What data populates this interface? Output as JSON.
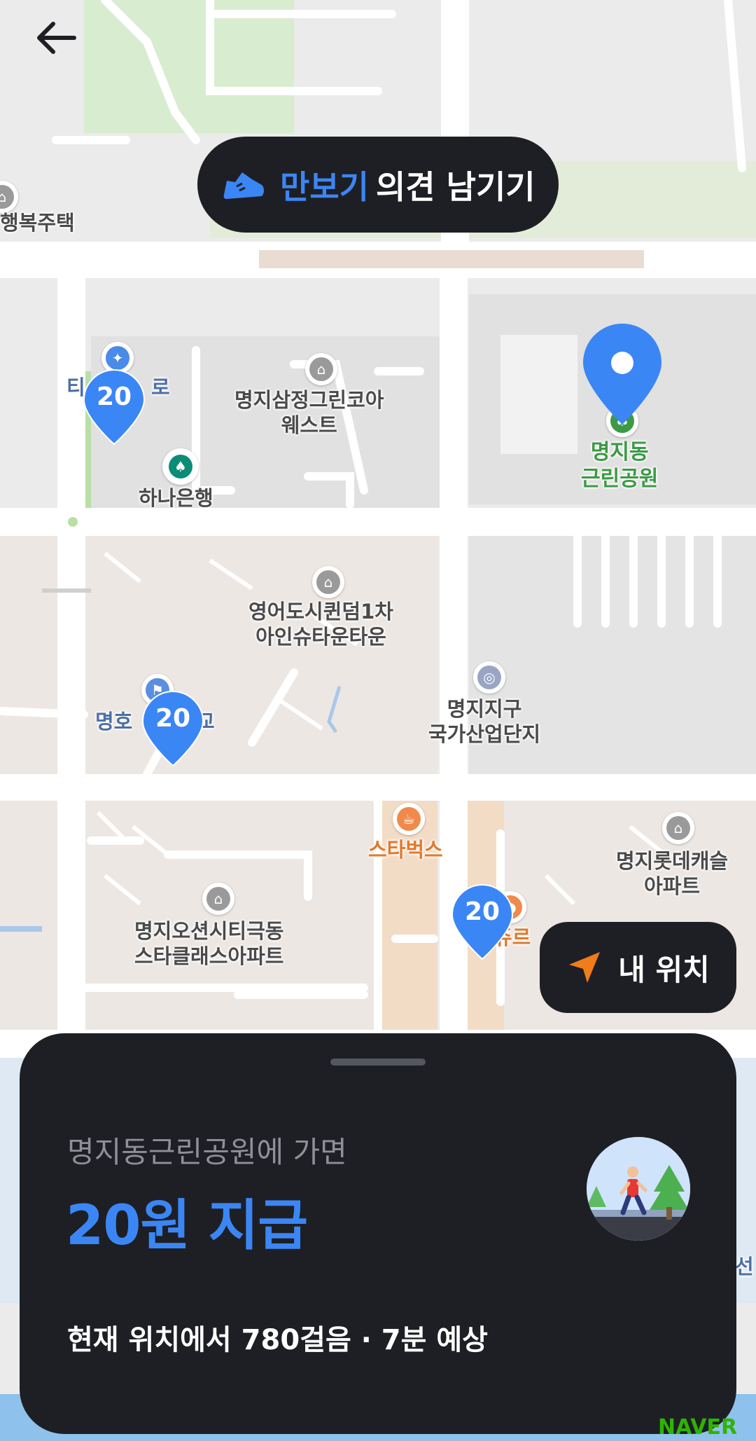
{
  "map": {
    "labels": {
      "haengbok": "행복주택",
      "myeongji_samjeong": "명지삼정그린코아\n웨스트",
      "hana_bank": "하나은행",
      "park": "명지동\n근린공원",
      "english_city": "영어도시퀸덤1차\n아인슈타운타운",
      "industrial": "명지지구\n국가산업단지",
      "school_left": "명호",
      "school_right": "교",
      "partial_road": "티",
      "partial_road2": "로",
      "starbucks": "스타벅스",
      "lotte_castle": "명지롯데캐슬\n아파트",
      "ocean_city": "명지오션시티극동\n스타클래스아파트",
      "partial_right": "선",
      "partial_shop": "쥬르"
    },
    "pins": [
      {
        "value": "20"
      },
      {
        "value": "20"
      },
      {
        "value": "20"
      }
    ],
    "provider": "NAVER"
  },
  "feedback_button": {
    "highlight": "만보기",
    "rest": "의견 남기기"
  },
  "my_location_button": {
    "label": "내 위치"
  },
  "sheet": {
    "subtitle": "명지동근린공원에 가면",
    "reward": "20원 지급",
    "distance": "현재 위치에서 780걸음 · 7분 예상"
  },
  "colors": {
    "accent": "#3b86f5",
    "dark": "#1e1f24",
    "orange": "#f07c1a"
  },
  "icons": {
    "back": "arrow-left-icon",
    "feedback": "sneaker-icon",
    "location": "navigation-arrow-icon",
    "avatar": "walking-person-illustration"
  }
}
